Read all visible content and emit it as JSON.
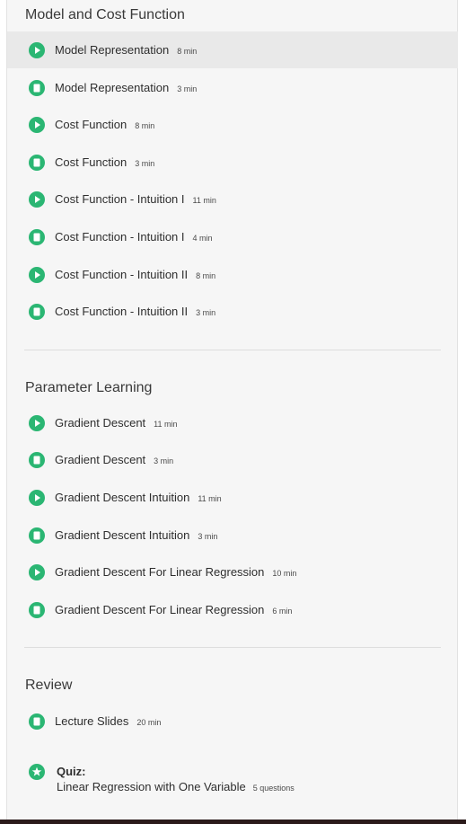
{
  "sections": [
    {
      "title": "Model and Cost Function",
      "items": [
        {
          "type": "video",
          "label": "Model Representation",
          "duration": "8 min"
        },
        {
          "type": "reading",
          "label": "Model Representation",
          "duration": "3 min"
        },
        {
          "type": "video",
          "label": "Cost Function",
          "duration": "8 min"
        },
        {
          "type": "reading",
          "label": "Cost Function",
          "duration": "3 min"
        },
        {
          "type": "video",
          "label": "Cost Function - Intuition I",
          "duration": "11 min"
        },
        {
          "type": "reading",
          "label": "Cost Function - Intuition I",
          "duration": "4 min"
        },
        {
          "type": "video",
          "label": "Cost Function - Intuition II",
          "duration": "8 min"
        },
        {
          "type": "reading",
          "label": "Cost Function - Intuition II",
          "duration": "3 min"
        }
      ]
    },
    {
      "title": "Parameter Learning",
      "items": [
        {
          "type": "video",
          "label": "Gradient Descent",
          "duration": "11 min"
        },
        {
          "type": "reading",
          "label": "Gradient Descent",
          "duration": "3 min"
        },
        {
          "type": "video",
          "label": "Gradient Descent Intuition",
          "duration": "11 min"
        },
        {
          "type": "reading",
          "label": "Gradient Descent Intuition",
          "duration": "3 min"
        },
        {
          "type": "video",
          "label": "Gradient Descent For Linear Regression",
          "duration": "10 min"
        },
        {
          "type": "reading",
          "label": "Gradient Descent For Linear Regression",
          "duration": "6 min"
        }
      ]
    },
    {
      "title": "Review",
      "items": [
        {
          "type": "reading",
          "label": "Lecture Slides",
          "duration": "20 min"
        }
      ],
      "quiz": {
        "heading": "Quiz:",
        "name": "Linear Regression with One Variable",
        "count": "5 questions"
      }
    }
  ],
  "colors": {
    "accent": "#2bb673",
    "panel_bg": "#f6f6f6",
    "active_bg": "#e9e9e9"
  },
  "icons": {
    "video": "play-icon",
    "reading": "document-icon",
    "quiz": "star-icon"
  }
}
